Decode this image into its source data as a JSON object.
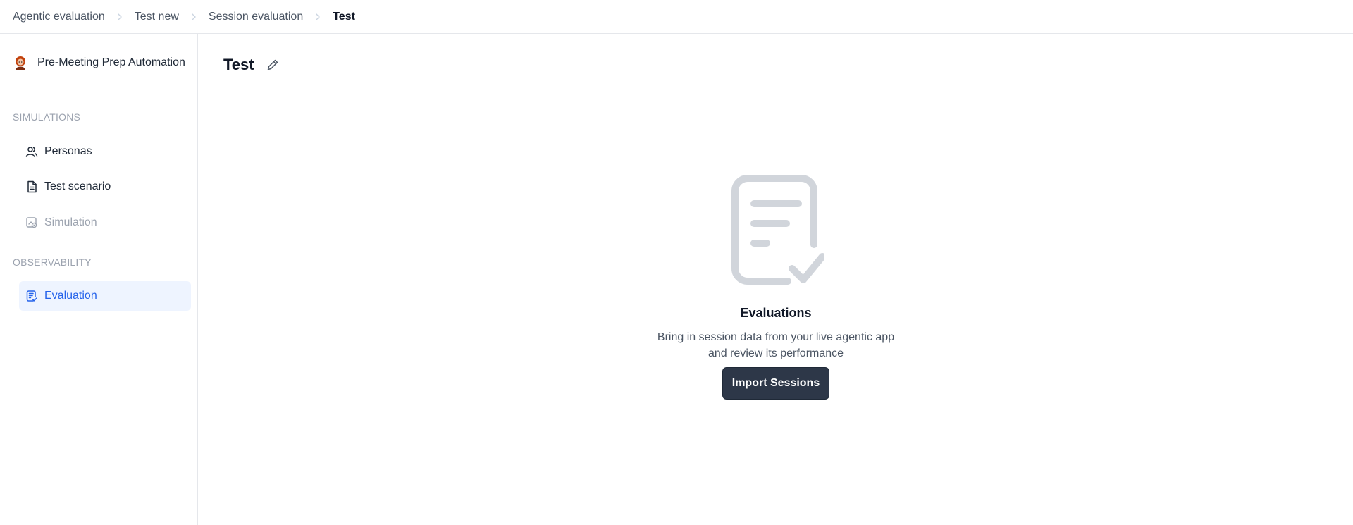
{
  "breadcrumb": {
    "items": [
      "Agentic evaluation",
      "Test new",
      "Session evaluation"
    ],
    "current": "Test"
  },
  "sidebar": {
    "project_name": "Pre-Meeting Prep Automation",
    "sections": {
      "simulations": "SIMULATIONS",
      "observability": "OBSERVABILITY"
    },
    "items": [
      {
        "label": "Personas",
        "icon": "users-icon",
        "state": "normal"
      },
      {
        "label": "Test scenario",
        "icon": "document-icon",
        "state": "normal"
      },
      {
        "label": "Simulation",
        "icon": "simulation-icon",
        "state": "disabled"
      },
      {
        "label": "Evaluation",
        "icon": "evaluation-icon",
        "state": "active"
      }
    ]
  },
  "main": {
    "title": "Test",
    "empty_state": {
      "title": "Evaluations",
      "description": "Bring in session data from your live agentic app and review its performance",
      "button_label": "Import Sessions"
    }
  },
  "colors": {
    "accent": "#2563eb",
    "active_bg": "#eef4ff",
    "button_bg": "#2d3748",
    "muted": "#9ca3af",
    "illustration": "#d1d5db"
  }
}
